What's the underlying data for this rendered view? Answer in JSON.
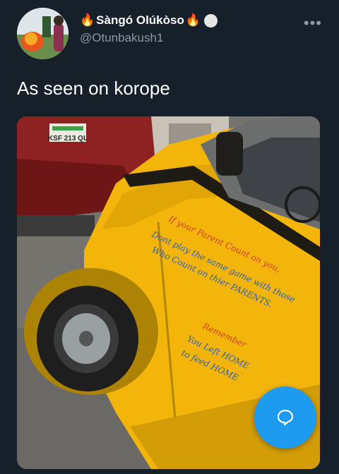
{
  "author": {
    "display_name": "Sàngó Olúkòso",
    "name_emoji": "🔥",
    "handle": "@Otunbakush1"
  },
  "more_label": "•••",
  "tweet": {
    "text": "As seen on korope"
  },
  "media": {
    "plate_text": "KSF 213 QL",
    "van_lines": [
      "If your Parent Count on you,",
      "Dont play the same game with those",
      "Who Count on thier PARENTS.",
      "Remember",
      "You Left HOME",
      "to feed HOME"
    ]
  },
  "icons": {
    "fab": "compose-reply-icon"
  },
  "colors": {
    "background": "#15202b",
    "accent": "#1d9bf0",
    "muted": "#8b98a5"
  }
}
